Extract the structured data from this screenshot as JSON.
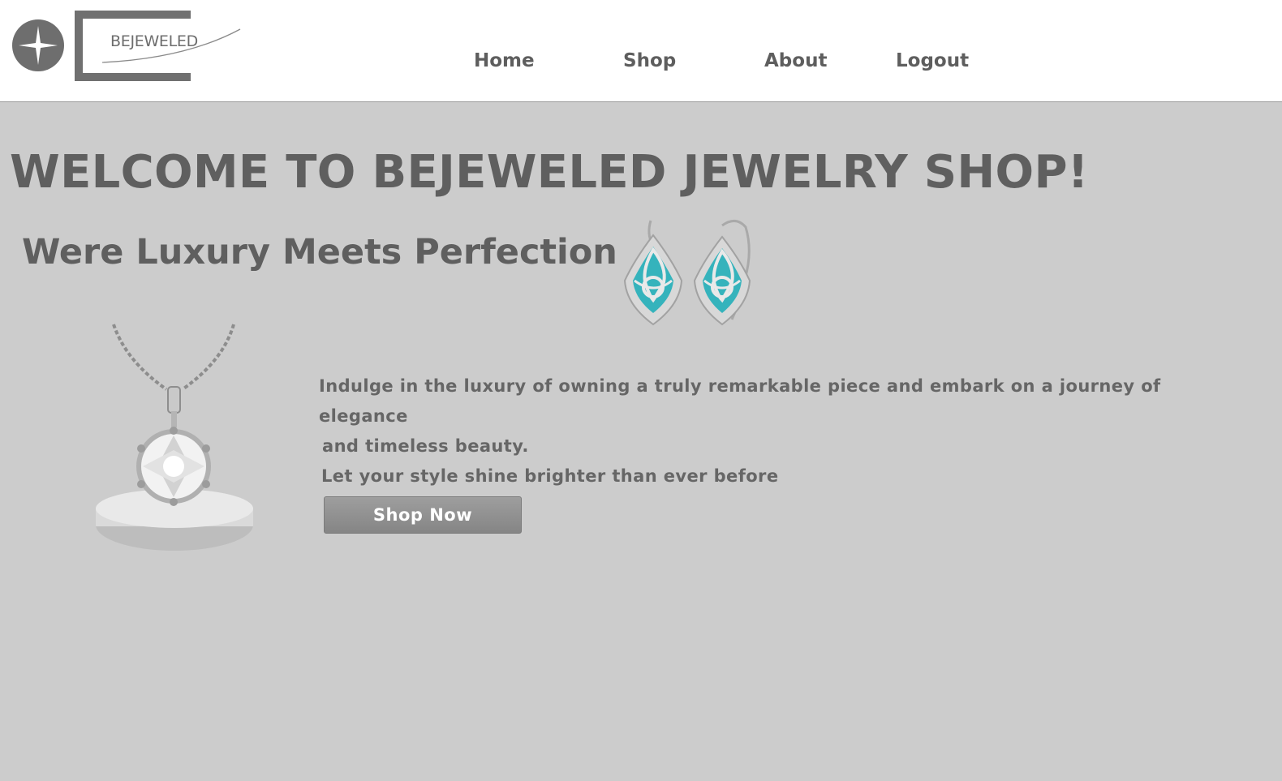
{
  "brand": {
    "logo_text": "BEJEWELED"
  },
  "nav": {
    "home": "Home",
    "shop": "Shop",
    "about": "About",
    "logout": "Logout"
  },
  "hero": {
    "welcome": "WELCOME TO BEJEWELED JEWELRY SHOP!",
    "tagline": "Were Luxury Meets Perfection",
    "description_line1": "Indulge in the luxury of owning a truly remarkable piece and embark on a journey of elegance",
    "description_line2": "and timeless beauty.",
    "description_line3": "Let your style shine brighter than ever before",
    "cta_label": "Shop Now"
  },
  "images": {
    "earrings": "turquoise-earrings-image",
    "necklace": "diamond-necklace-image"
  },
  "colors": {
    "page_background": "#cccccc",
    "header_background": "#ffffff",
    "text_primary": "#5f5f5f",
    "button_background": "#8f8f8f",
    "gem_turquoise": "#35b3bc"
  }
}
